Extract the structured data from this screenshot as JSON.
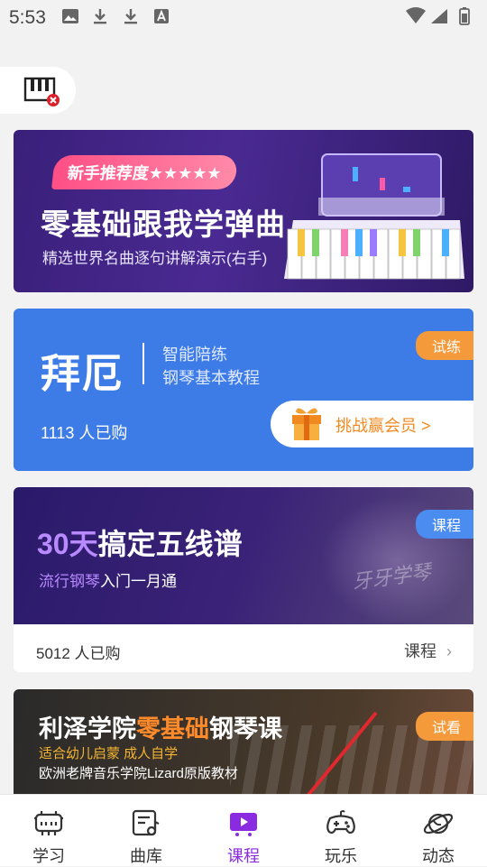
{
  "status_bar": {
    "time": "5:53",
    "icons": [
      "image-icon",
      "download-icon",
      "download-icon",
      "a-badge-icon"
    ],
    "right_icons": [
      "wifi-icon",
      "signal-icon",
      "battery-icon"
    ]
  },
  "top": {
    "piano_icon": "piano-icon"
  },
  "cards": [
    {
      "badge": "新手推荐度★★★★★",
      "title": "零基础跟我学弹曲",
      "subtitle": "精选世界名曲逐句讲解演示(右手)"
    },
    {
      "title": "拜厄",
      "sub1": "智能陪练",
      "sub2": "钢琴基本教程",
      "tag": "试练",
      "purchases": "1113 人已购",
      "challenge": "挑战赢会员 >"
    },
    {
      "title_highlight": "30天",
      "title_rest": "搞定五线谱",
      "sub_highlight": "流行钢琴",
      "sub_rest": "入门一月通",
      "tag": "课程",
      "watermark": "牙牙学琴",
      "purchases": "5012 人已购",
      "link": "课程"
    },
    {
      "title_part1": "利泽学院",
      "title_highlight": "零基础",
      "title_part2": "钢琴课",
      "sub1": "适合幼儿启蒙 成人自学",
      "sub2": "欧洲老牌音乐学院Lizard原版教材",
      "tag": "试看"
    }
  ],
  "bottom_nav": [
    {
      "label": "学习",
      "icon": "study-icon",
      "active": false
    },
    {
      "label": "曲库",
      "icon": "library-icon",
      "active": false
    },
    {
      "label": "课程",
      "icon": "course-play-icon",
      "active": true
    },
    {
      "label": "玩乐",
      "icon": "gamepad-icon",
      "active": false
    },
    {
      "label": "动态",
      "icon": "planet-icon",
      "active": false
    }
  ],
  "colors": {
    "accent": "#8a2be2",
    "tag_orange": "#f59a3a",
    "tag_blue": "#4a8cf0",
    "card_blue": "#3d7be7"
  }
}
